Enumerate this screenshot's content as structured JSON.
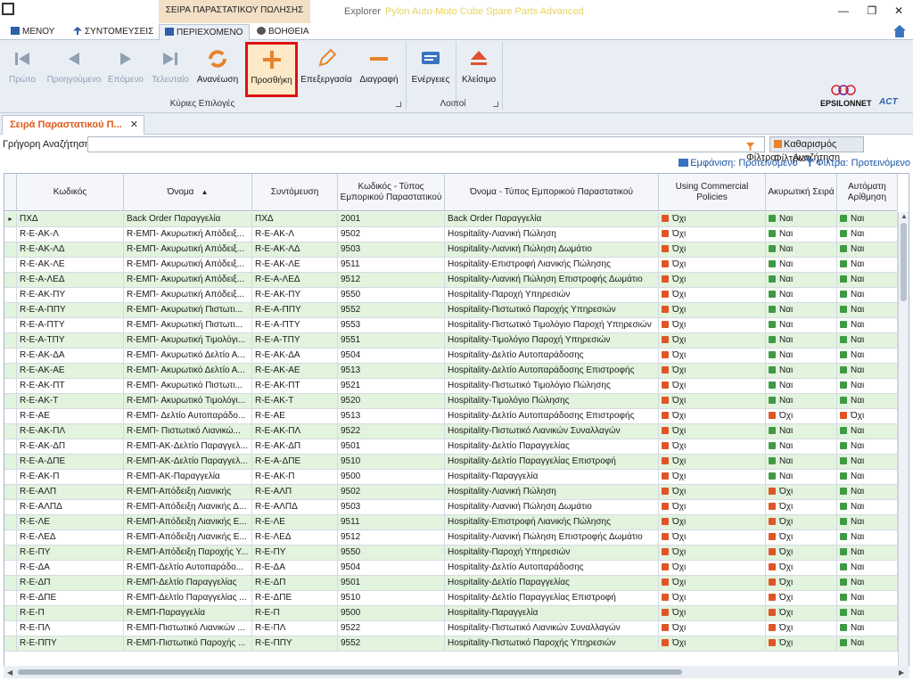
{
  "window": {
    "context_tab": "ΣΕΙΡΑ ΠΑΡΑΣΤΑΤΙΚΟΥ ΠΩΛΗΣΗΣ",
    "explorer": "Explorer",
    "app_title": "Pylon Auto-Moto Cube Spare Parts Advanced",
    "min": "—",
    "max": "❐",
    "close": "✕"
  },
  "tabs": [
    "ΜΕΝΟΥ",
    "ΣΥΝΤΟΜΕΥΣΕΙΣ",
    "ΠΕΡΙΕΧΟΜΕΝΟ",
    "ΒΟΗΘΕΙΑ"
  ],
  "ribbon": {
    "first": "Πρώτο",
    "prev": "Προηγούμενο",
    "next": "Επόμενο",
    "last": "Τελευταίο",
    "refresh": "Ανανέωση",
    "add": "Προσθήκη",
    "edit": "Επεξεργασία",
    "delete": "Διαγραφή",
    "actions": "Ενέργειες",
    "close": "Κλείσιμο",
    "group_main": "Κύριες Επιλογές",
    "group_other": "Λοιποί",
    "logo1": "EPSILONNET",
    "logo2": "ACT"
  },
  "doc_tab": "Σειρά Παραστατικού Π...",
  "search": {
    "label": "Γρήγορη Αναζήτηση",
    "filter": "Φίλτρα",
    "search": "Αναζήτηση",
    "clear": "Καθαρισμός Φίλτρων"
  },
  "view": {
    "display": "Εμφάνιση: Προτεινόμενο",
    "filters": "Φίλτρα: Προτεινόμενο"
  },
  "colors": {
    "accent": "#e05a1a",
    "alt_row": "#e2f3de",
    "highlight": "#e01010"
  },
  "grid": {
    "columns": [
      "Κωδικός",
      "Όνομα",
      "Συντόμευση",
      "Κωδικός - Τύπος Εμπορικού Παραστατικού",
      "Όνομα - Τύπος Εμπορικού Παραστατικού",
      "Using Commercial Policies",
      "Ακυρωτική Σειρά",
      "Αυτόματη Αρίθμηση"
    ],
    "rows": [
      [
        "ΠΧΔ",
        "Back Order Παραγγελία",
        "ΠΧΔ",
        "2001",
        "Back Order Παραγγελία",
        "Όχι",
        "Ναι",
        "Ναι"
      ],
      [
        "R-E-AK-Λ",
        "R-ΕΜΠ- Ακυρωτική Απόδειξ...",
        "R-E-AK-Λ",
        "9502",
        "Hospitality-Λιανική Πώληση",
        "Όχι",
        "Ναι",
        "Ναι"
      ],
      [
        "R-E-AK-ΛΔ",
        "R-ΕΜΠ- Ακυρωτική Απόδειξ...",
        "R-E-AK-ΛΔ",
        "9503",
        "Hospitality-Λιανική Πώληση Δωμάτιο",
        "Όχι",
        "Ναι",
        "Ναι"
      ],
      [
        "R-E-AK-ΛΕ",
        "R-ΕΜΠ- Ακυρωτική Απόδειξ...",
        "R-E-AK-ΛΕ",
        "9511",
        "Hospitality-Επιστροφή Λιανικής Πώλησης",
        "Όχι",
        "Ναι",
        "Ναι"
      ],
      [
        "R-E-A-ΛΕΔ",
        "R-ΕΜΠ- Ακυρωτική Απόδειξ...",
        "R-E-A-ΛΕΔ",
        "9512",
        "Hospitality-Λιανική Πώληση Επιστροφής Δωμάτιο",
        "Όχι",
        "Ναι",
        "Ναι"
      ],
      [
        "R-E-AK-ΠΥ",
        "R-ΕΜΠ- Ακυρωτική Απόδειξ...",
        "R-E-AK-ΠΥ",
        "9550",
        "Hospitality-Παροχή Υπηρεσιών",
        "Όχι",
        "Ναι",
        "Ναι"
      ],
      [
        "R-E-A-ΠΠΥ",
        "R-ΕΜΠ- Ακυρωτική Πιστωτι...",
        "R-E-A-ΠΠΥ",
        "9552",
        "Hospitality-Πιστωτικό Παροχής Υπηρεσιών",
        "Όχι",
        "Ναι",
        "Ναι"
      ],
      [
        "R-E-A-ΠΤΥ",
        "R-ΕΜΠ- Ακυρωτική Πιστωτι...",
        "R-E-A-ΠΤΥ",
        "9553",
        "Hospitality-Πιστωτικό Τιμολόγιο Παροχή Υπηρεσιών",
        "Όχι",
        "Ναι",
        "Ναι"
      ],
      [
        "R-E-A-ΤΠΥ",
        "R-ΕΜΠ- Ακυρωτική Τιμολόγι...",
        "R-E-A-ΤΠΥ",
        "9551",
        "Hospitality-Τιμολόγιο Παροχή Υπηρεσιών",
        "Όχι",
        "Ναι",
        "Ναι"
      ],
      [
        "R-E-AK-ΔΑ",
        "R-ΕΜΠ- Ακυρωτικό Δελτίο Α...",
        "R-E-AK-ΔΑ",
        "9504",
        "Hospitality-Δελτίο Αυτοπαράδοσης",
        "Όχι",
        "Ναι",
        "Ναι"
      ],
      [
        "R-E-AK-ΑΕ",
        "R-ΕΜΠ- Ακυρωτικό Δελτίο Α...",
        "R-E-AK-ΑΕ",
        "9513",
        "Hospitality-Δελτίο Αυτοπαράδοσης Επιστροφής",
        "Όχι",
        "Ναι",
        "Ναι"
      ],
      [
        "R-E-AK-ΠΤ",
        "R-ΕΜΠ- Ακυρωτικό Πιστωτι...",
        "R-E-AK-ΠΤ",
        "9521",
        "Hospitality-Πιστωτικό Τιμολόγιο Πώλησης",
        "Όχι",
        "Ναι",
        "Ναι"
      ],
      [
        "R-E-AK-Τ",
        "R-ΕΜΠ- Ακυρωτικό Τιμολόγι...",
        "R-E-AK-Τ",
        "9520",
        "Hospitality-Τιμολόγιο Πώλησης",
        "Όχι",
        "Ναι",
        "Ναι"
      ],
      [
        "R-E-AE",
        "R-ΕΜΠ- Δελτίο Αυτοπαράδο...",
        "R-E-AE",
        "9513",
        "Hospitality-Δελτίο Αυτοπαράδοσης Επιστροφής",
        "Όχι",
        "Όχι",
        "Όχι"
      ],
      [
        "R-E-AK-ΠΛ",
        "R-ΕΜΠ- Πιστωτικό Λιανικώ...",
        "R-E-AK-ΠΛ",
        "9522",
        "Hospitality-Πιστωτικό Λιανικών Συναλλαγών",
        "Όχι",
        "Ναι",
        "Ναι"
      ],
      [
        "R-E-AK-ΔΠ",
        "R-ΕΜΠ-ΑΚ-Δελτίο Παραγγελ...",
        "R-E-AK-ΔΠ",
        "9501",
        "Hospitality-Δελτίο Παραγγελίας",
        "Όχι",
        "Ναι",
        "Ναι"
      ],
      [
        "R-E-A-ΔΠΕ",
        "R-ΕΜΠ-ΑΚ-Δελτίο Παραγγελ...",
        "R-E-A-ΔΠΕ",
        "9510",
        "Hospitality-Δελτίο Παραγγελίας Επιστροφή",
        "Όχι",
        "Ναι",
        "Ναι"
      ],
      [
        "R-E-AK-Π",
        "R-ΕΜΠ-ΑΚ-Παραγγελία",
        "R-E-AK-Π",
        "9500",
        "Hospitality-Παραγγελία",
        "Όχι",
        "Ναι",
        "Ναι"
      ],
      [
        "R-E-ΑΛΠ",
        "R-ΕΜΠ-Απόδειξη Λιανικής",
        "R-E-ΑΛΠ",
        "9502",
        "Hospitality-Λιανική Πώληση",
        "Όχι",
        "Όχι",
        "Ναι"
      ],
      [
        "R-E-ΑΛΠΔ",
        "R-ΕΜΠ-Απόδειξη Λιανικής Δ...",
        "R-E-ΑΛΠΔ",
        "9503",
        "Hospitality-Λιανική Πώληση Δωμάτιο",
        "Όχι",
        "Όχι",
        "Ναι"
      ],
      [
        "R-E-ΛΕ",
        "R-ΕΜΠ-Απόδειξη Λιανικής Ε...",
        "R-E-ΛΕ",
        "9511",
        "Hospitality-Επιστροφή Λιανικής Πώλησης",
        "Όχι",
        "Όχι",
        "Ναι"
      ],
      [
        "R-E-ΛΕΔ",
        "R-ΕΜΠ-Απόδειξη Λιανικής Ε...",
        "R-E-ΛΕΔ",
        "9512",
        "Hospitality-Λιανική Πώληση Επιστροφής Δωμάτιο",
        "Όχι",
        "Όχι",
        "Ναι"
      ],
      [
        "R-E-ΠΥ",
        "R-ΕΜΠ-Απόδειξη Παροχής Υ...",
        "R-E-ΠΥ",
        "9550",
        "Hospitality-Παροχή Υπηρεσιών",
        "Όχι",
        "Όχι",
        "Ναι"
      ],
      [
        "R-E-ΔΑ",
        "R-ΕΜΠ-Δελτίο Αυτοπαράδο...",
        "R-E-ΔΑ",
        "9504",
        "Hospitality-Δελτίο Αυτοπαράδοσης",
        "Όχι",
        "Όχι",
        "Ναι"
      ],
      [
        "R-E-ΔΠ",
        "R-ΕΜΠ-Δελτίο Παραγγελίας",
        "R-E-ΔΠ",
        "9501",
        "Hospitality-Δελτίο Παραγγελίας",
        "Όχι",
        "Όχι",
        "Ναι"
      ],
      [
        "R-E-ΔΠΕ",
        "R-ΕΜΠ-Δελτίο Παραγγελίας ...",
        "R-E-ΔΠΕ",
        "9510",
        "Hospitality-Δελτίο Παραγγελίας Επιστροφή",
        "Όχι",
        "Όχι",
        "Ναι"
      ],
      [
        "R-E-Π",
        "R-ΕΜΠ-Παραγγελία",
        "R-E-Π",
        "9500",
        "Hospitality-Παραγγελία",
        "Όχι",
        "Όχι",
        "Ναι"
      ],
      [
        "R-E-ΠΛ",
        "R-ΕΜΠ-Πιστωτικό Λιανικών ...",
        "R-E-ΠΛ",
        "9522",
        "Hospitality-Πιστωτικό Λιανικών Συναλλαγών",
        "Όχι",
        "Όχι",
        "Ναι"
      ],
      [
        "R-E-ΠΠΥ",
        "R-ΕΜΠ-Πιστωτικό Παροχής ...",
        "R-E-ΠΠΥ",
        "9552",
        "Hospitality-Πιστωτικό Παροχής Υπηρεσιών",
        "Όχι",
        "Όχι",
        "Ναι"
      ]
    ]
  }
}
